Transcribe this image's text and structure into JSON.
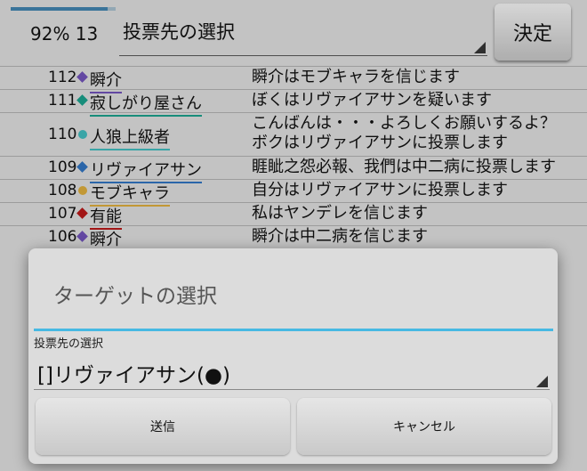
{
  "header": {
    "progress_fraction": 0.92,
    "status_text": "92% 13",
    "target_label": "投票先の選択",
    "decide_button": "決定"
  },
  "log": [
    {
      "num": "112",
      "name": "瞬介",
      "message": "瞬介はモブキャラを信じます",
      "color": "#6c4fb0",
      "shape": "diamond"
    },
    {
      "num": "111",
      "name": "寂しがり屋さん",
      "message": "ぼくはリヴァイアサンを疑います",
      "color": "#1a9a86",
      "shape": "diamond"
    },
    {
      "num": "110",
      "name": "人狼上級者",
      "message": "こんばんは・・・よろしくお願いするよ？\nボクはリヴァイアサンに投票します",
      "color": "#3fb3b6",
      "shape": "circle",
      "tall": true
    },
    {
      "num": "109",
      "name": "リヴァイアサン",
      "message": "睚眦之怨必報、我們は中二病に投票します",
      "color": "#2f6fb8",
      "shape": "diamond"
    },
    {
      "num": "108",
      "name": "モブキャラ",
      "message": "自分はリヴァイアサンに投票します",
      "color": "#d3a53a",
      "shape": "circle"
    },
    {
      "num": "107",
      "name": "有能",
      "message": "私はヤンデレを信じます",
      "color": "#b01818",
      "shape": "diamond"
    },
    {
      "num": "106",
      "name": "瞬介",
      "message": "瞬介は中二病を信じます",
      "color": "#6c4fb0",
      "shape": "diamond"
    }
  ],
  "dialog": {
    "title": "ターゲットの選択",
    "field_label": "投票先の選択",
    "selected_value": "[]リヴァイアサン(●)",
    "send_button": "送信",
    "cancel_button": "キャンセル",
    "accent_color": "#47b9e3"
  }
}
